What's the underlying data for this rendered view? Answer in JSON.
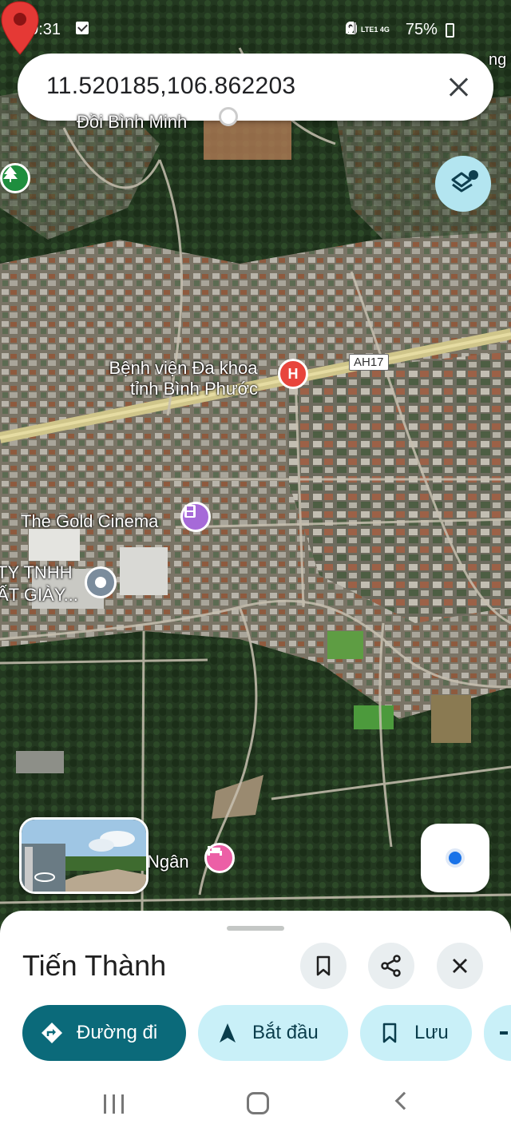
{
  "status_bar": {
    "time": "09:31",
    "network": "LTE1 4G",
    "battery": "75%"
  },
  "search": {
    "query": "11.520185,106.862203"
  },
  "map": {
    "labels": {
      "top_place": "Đồi Bình Minh",
      "hospital_line1": "Bệnh viện Đa khoa",
      "hospital_line2": "tỉnh Bình Phước",
      "road_shield": "AH17",
      "cinema": "The Gold Cinema",
      "company_line1": "TY TNHH",
      "company_line2": "ẤT GIÀY...",
      "lodging": "Ngân",
      "right_edge": "ng V"
    },
    "icons": {
      "park": "tree-icon",
      "hospital": "hospital-icon",
      "cinema": "film-icon",
      "company": "place-icon",
      "lodging": "bed-icon",
      "dropped_pin": "red-pin-icon"
    },
    "colors": {
      "hospital": "#e8453c",
      "cinema": "#a66ad8",
      "lodging": "#ec5fa6",
      "park": "#1e8e3e",
      "company": "#7b8c9c",
      "pin": "#e53935",
      "highway": "#cfc58a"
    }
  },
  "place": {
    "title": "Tiến Thành"
  },
  "actions": {
    "directions": "Đường đi",
    "start": "Bắt đầu",
    "save": "Lưu"
  },
  "theme": {
    "primary": "#0b6a7a",
    "secondary": "#c9f0f8"
  }
}
